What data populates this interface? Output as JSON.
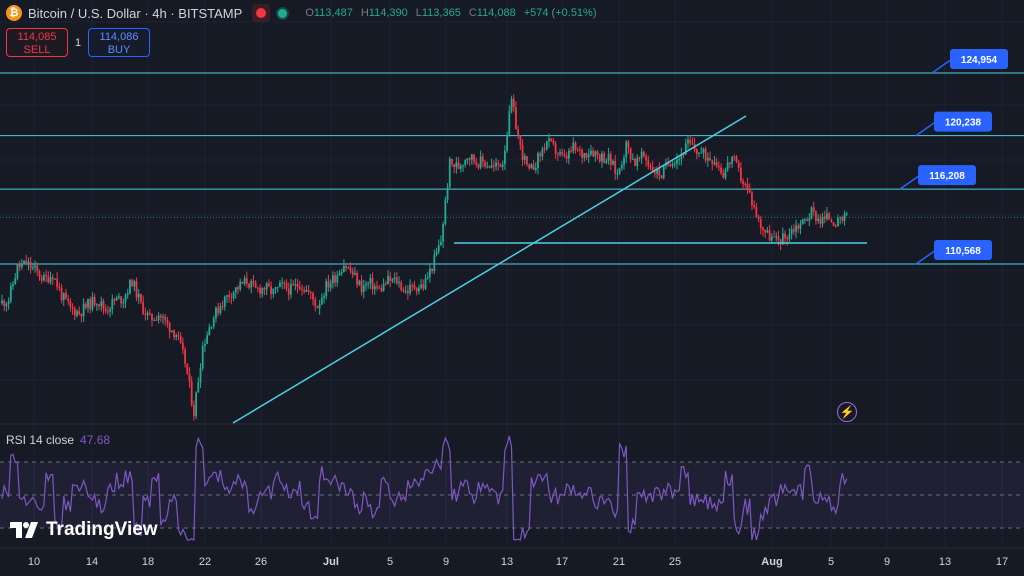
{
  "header": {
    "coin_symbol": "₿",
    "symbol_title": "Bitcoin / U.S. Dollar · 4h · BITSTAMP",
    "ohlc": [
      {
        "k": "O",
        "v": "113,487"
      },
      {
        "k": "H",
        "v": "114,390"
      },
      {
        "k": "L",
        "v": "113,365"
      },
      {
        "k": "C",
        "v": "114,088"
      }
    ],
    "change": "+574 (+0.51%)"
  },
  "trade": {
    "sell_price": "114,085",
    "sell_label": "SELL",
    "quantity": "1",
    "buy_price": "114,086",
    "buy_label": "BUY"
  },
  "price_labels": [
    "124,954",
    "120,238",
    "116,208",
    "110,568"
  ],
  "rsi": {
    "label": "RSI 14 close",
    "value": "47.68"
  },
  "time_axis": [
    "10",
    "14",
    "18",
    "22",
    "26",
    "Jul",
    "5",
    "9",
    "13",
    "17",
    "21",
    "25",
    "Aug",
    "5",
    "9",
    "13",
    "17"
  ],
  "brand": "TradingView",
  "colors": {
    "background": "#161a25",
    "up": "#22ab94",
    "down": "#f23645",
    "drawing": "#4dd0e1",
    "label_bg": "#2962ff",
    "rsi": "#7e57c2"
  },
  "chart_data": {
    "type": "candlestick",
    "timeframe": "4h",
    "horizontal_levels": [
      124954,
      120238,
      116208,
      110568
    ],
    "price_path": [
      107600,
      107900,
      110300,
      110600,
      110100,
      109400,
      109800,
      108200,
      107200,
      106900,
      107500,
      107900,
      107100,
      107800,
      108000,
      109300,
      107500,
      106400,
      106800,
      106000,
      105300,
      103200,
      99400,
      104400,
      106300,
      107500,
      108300,
      108800,
      109300,
      108600,
      108800,
      108400,
      108900,
      108600,
      109100,
      108400,
      107400,
      108900,
      109600,
      110600,
      109800,
      108800,
      109100,
      108600,
      109300,
      109300,
      108500,
      108900,
      108900,
      110400,
      112300,
      118100,
      117900,
      118800,
      118300,
      118200,
      117800,
      118300,
      122800,
      119300,
      117400,
      118500,
      119800,
      119100,
      118400,
      119300,
      118800,
      119200,
      118700,
      118500,
      117300,
      119500,
      118200,
      118700,
      117700,
      117300,
      118400,
      118600,
      119600,
      119100,
      118700,
      118500,
      117400,
      118600,
      117100,
      115800,
      113800,
      112800,
      112300,
      112600,
      113300,
      113700,
      114500,
      113900,
      114100,
      113600,
      114088
    ]
  }
}
